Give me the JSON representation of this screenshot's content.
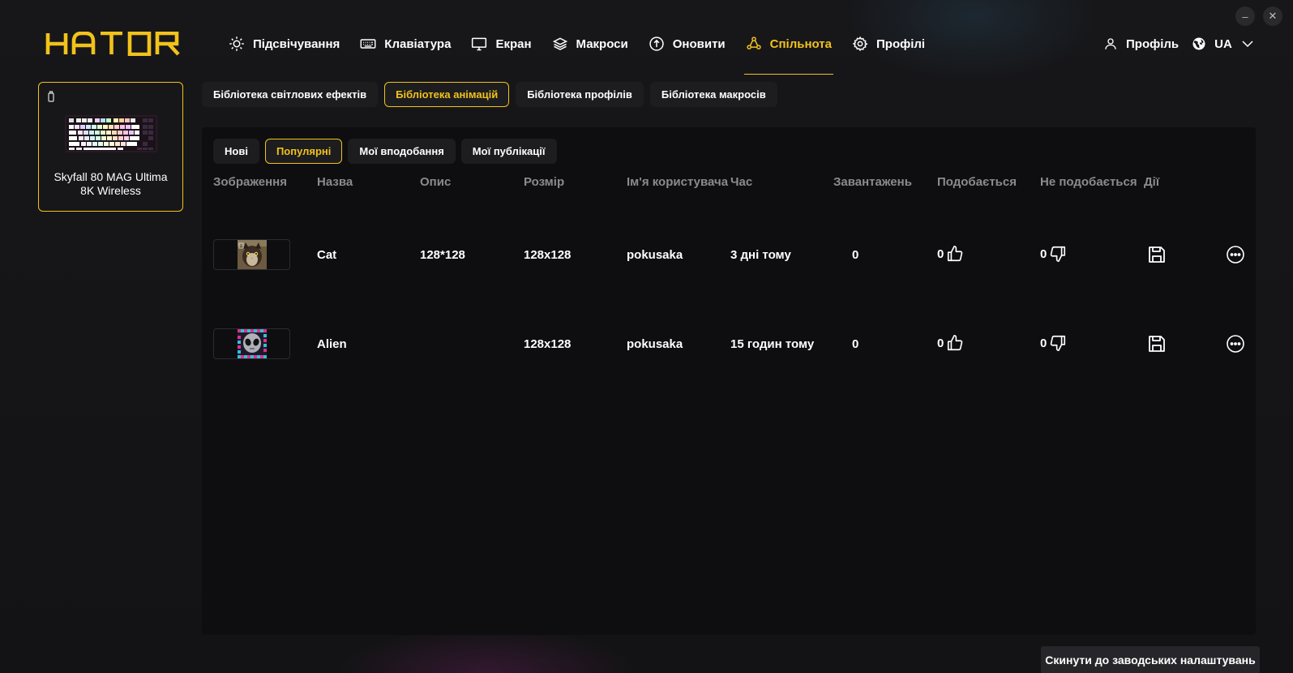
{
  "window": {
    "minimize_glyph": "–",
    "close_glyph": "✕"
  },
  "brand": {
    "logo_text": "HATOR",
    "accent_color": "#f2c21b"
  },
  "nav": [
    {
      "label": "Підсвічування",
      "icon": "sun-icon"
    },
    {
      "label": "Клавіатура",
      "icon": "keyboard-icon"
    },
    {
      "label": "Екран",
      "icon": "monitor-icon"
    },
    {
      "label": "Макроси",
      "icon": "layers-icon"
    },
    {
      "label": "Оновити",
      "icon": "upload-circle-icon"
    },
    {
      "label": "Спільнота",
      "icon": "community-icon",
      "active": true
    },
    {
      "label": "Профілі",
      "icon": "gear-icon"
    }
  ],
  "header_right": {
    "profile_label": "Профіль",
    "language": "UA"
  },
  "device": {
    "name": "Skyfall 80 MAG Ultima 8K Wireless"
  },
  "library_tabs": [
    {
      "label": "Бібліотека світлових ефектів"
    },
    {
      "label": "Бібліотека анімацій",
      "active": true
    },
    {
      "label": "Бібліотека профілів"
    },
    {
      "label": "Бібліотека макросів"
    }
  ],
  "filter_tabs": [
    {
      "label": "Нові"
    },
    {
      "label": "Популярні",
      "active": true
    },
    {
      "label": "Мої вподобання"
    },
    {
      "label": "Мої публікації"
    }
  ],
  "table": {
    "columns": [
      "Зображення",
      "Назва",
      "Опис",
      "Розмір",
      "Ім'я користувача",
      "Час",
      "Завантажень",
      "Подобається",
      "Не подобається",
      "Дії"
    ],
    "rows": [
      {
        "name": "Cat",
        "description": "128*128",
        "size": "128x128",
        "user": "pokusaka",
        "time": "3 дні тому",
        "downloads": "0",
        "likes": "0",
        "dislikes": "0"
      },
      {
        "name": "Alien",
        "description": "",
        "size": "128x128",
        "user": "pokusaka",
        "time": "15 годин тому",
        "downloads": "0",
        "likes": "0",
        "dislikes": "0"
      }
    ]
  },
  "reset_button": "Скинути до заводських налаштувань"
}
